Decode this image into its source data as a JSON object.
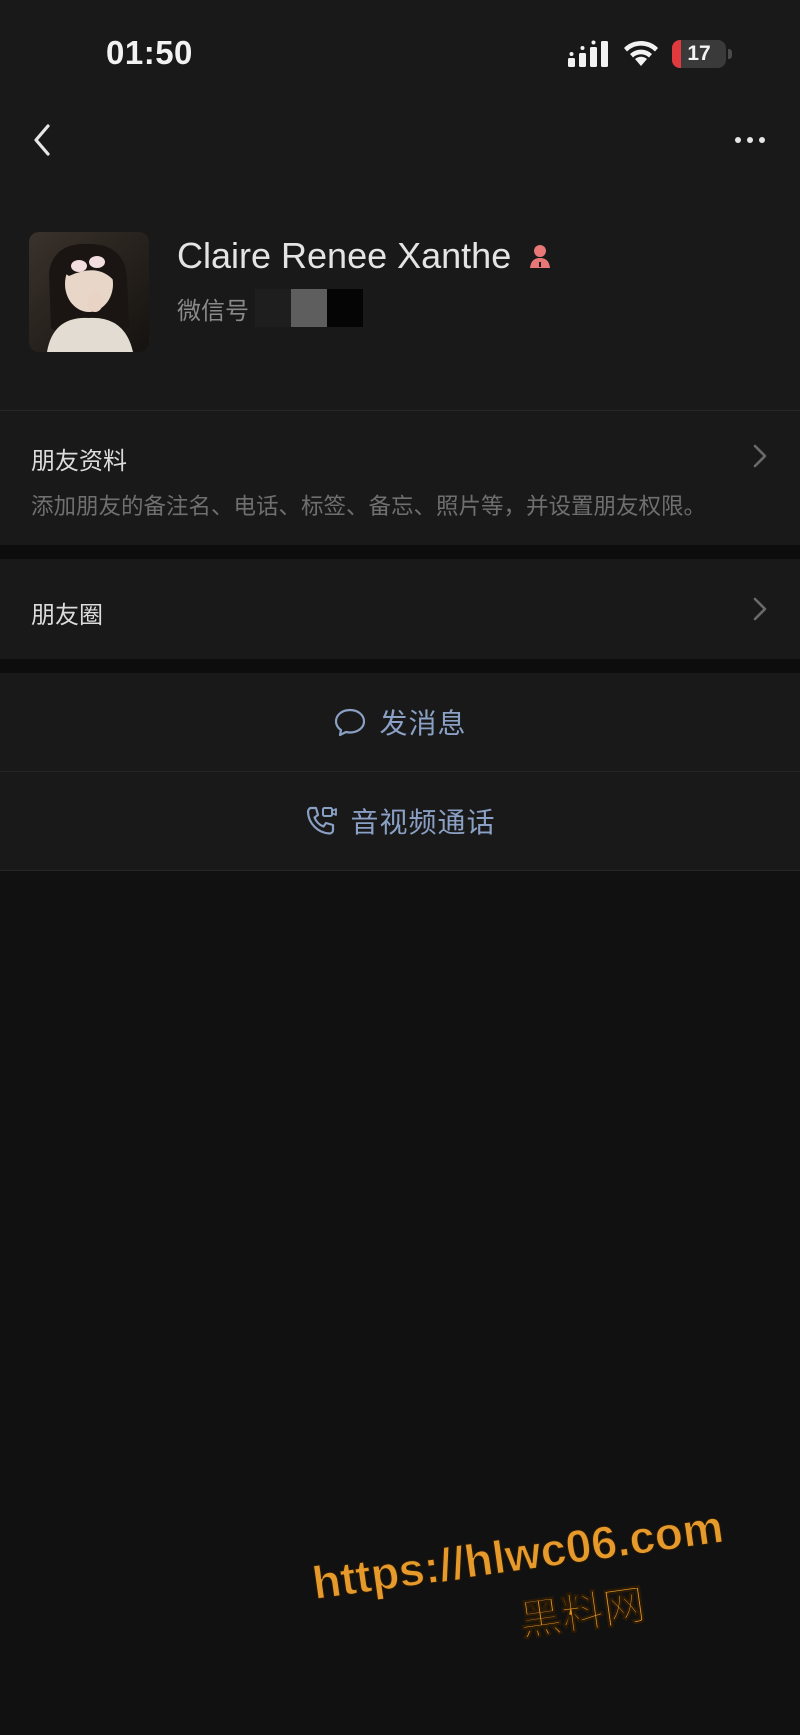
{
  "status_bar": {
    "time": "01:50",
    "battery_level": "17",
    "battery_color": "#e0393e"
  },
  "nav": {
    "back_icon": "chevron-left-icon",
    "more_icon": "ellipsis-icon"
  },
  "profile": {
    "nickname": "Claire Renee Xanthe",
    "gender_icon": "female-person-icon",
    "gender_color": "#e87878",
    "wechat_id_label": "微信号"
  },
  "rows": {
    "friend_profile": {
      "title": "朋友资料",
      "subtitle": "添加朋友的备注名、电话、标签、备忘、照片等，并设置朋友权限。"
    },
    "moments": {
      "title": "朋友圈"
    }
  },
  "actions": {
    "send_message": {
      "label": "发消息",
      "icon": "chat-bubble-icon"
    },
    "av_call": {
      "label": "音视频通话",
      "icon": "video-phone-icon"
    }
  },
  "accent_color": "#8aa0c4",
  "watermark": {
    "url": "https://hlwc06.com",
    "text": "黑料网"
  }
}
